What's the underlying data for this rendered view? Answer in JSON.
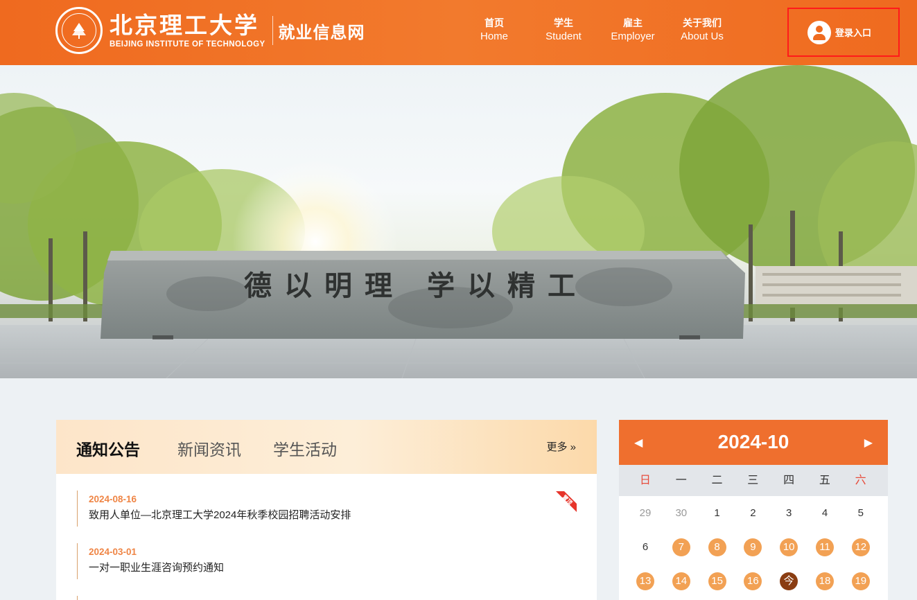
{
  "header": {
    "logo_cn": "北京理工大学",
    "logo_en": "BEIJING INSTITUTE OF TECHNOLOGY",
    "site_name": "就业信息网",
    "brand_color": "#ef6a1f",
    "nav": [
      {
        "cn": "首页",
        "en": "Home"
      },
      {
        "cn": "学生",
        "en": "Student"
      },
      {
        "cn": "雇主",
        "en": "Employer"
      },
      {
        "cn": "关于我们",
        "en": "About Us"
      }
    ],
    "login_label": "登录入口"
  },
  "banner": {
    "stone_inscription": "德以明理 学以精工",
    "icon": "campus-stone-photo"
  },
  "news": {
    "tabs": [
      "通知公告",
      "新闻资讯",
      "学生活动"
    ],
    "active_tab": 0,
    "more_label": "更多 »",
    "pinned_label": "置顶",
    "items": [
      {
        "date": "2024-08-16",
        "title": "致用人单位—北京理工大学2024年秋季校园招聘活动安排",
        "pinned": true
      },
      {
        "date": "2024-03-01",
        "title": "一对一职业生涯咨询预约通知",
        "pinned": false
      }
    ]
  },
  "calendar": {
    "title": "2024-10",
    "prev_icon": "chevron-left-icon",
    "next_icon": "chevron-right-icon",
    "weekdays": [
      "日",
      "一",
      "二",
      "三",
      "四",
      "五",
      "六"
    ],
    "weeks": [
      [
        {
          "d": "29",
          "s": "muted"
        },
        {
          "d": "30",
          "s": "muted"
        },
        {
          "d": "1",
          "s": ""
        },
        {
          "d": "2",
          "s": ""
        },
        {
          "d": "3",
          "s": ""
        },
        {
          "d": "4",
          "s": ""
        },
        {
          "d": "5",
          "s": ""
        }
      ],
      [
        {
          "d": "6",
          "s": ""
        },
        {
          "d": "7",
          "s": "event"
        },
        {
          "d": "8",
          "s": "event"
        },
        {
          "d": "9",
          "s": "event"
        },
        {
          "d": "10",
          "s": "event"
        },
        {
          "d": "11",
          "s": "event"
        },
        {
          "d": "12",
          "s": "event"
        }
      ],
      [
        {
          "d": "13",
          "s": "event"
        },
        {
          "d": "14",
          "s": "event"
        },
        {
          "d": "15",
          "s": "event"
        },
        {
          "d": "16",
          "s": "event"
        },
        {
          "d": "今",
          "s": "today"
        },
        {
          "d": "18",
          "s": "event"
        },
        {
          "d": "19",
          "s": "event"
        }
      ]
    ]
  }
}
